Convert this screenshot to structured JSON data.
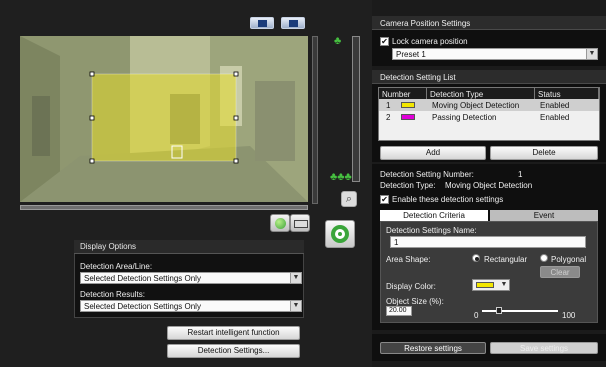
{
  "camera_view": {
    "toolbar": {
      "select_tool_icon": "pointer-icon",
      "window_tool_icon": "window-tool-icon"
    },
    "playback_status_icon": "green-status-dot-icon",
    "rectangle_tool_icon": "rectangle-tool-icon",
    "zoom_icon": "magnify-icon",
    "center_icon": "target-icon",
    "tree_icons": [
      "single-tree-icon",
      "multi-tree-icon"
    ]
  },
  "display_options": {
    "title": "Display Options",
    "area_label": "Detection Area/Line:",
    "area_value": "Selected Detection Settings Only",
    "results_label": "Detection Results:",
    "results_value": "Selected Detection Settings Only"
  },
  "left_buttons": {
    "restart": "Restart intelligent function",
    "settings": "Detection Settings..."
  },
  "camera_position": {
    "title": "Camera Position Settings",
    "lock_label": "Lock camera position",
    "lock_checked": true,
    "preset_value": "Preset 1"
  },
  "detection_list": {
    "title": "Detection Setting List",
    "columns": [
      "Number",
      "Detection Type",
      "Status"
    ],
    "rows": [
      {
        "number": "1",
        "color": "#f2e600",
        "type": "Moving Object Detection",
        "status": "Enabled"
      },
      {
        "number": "2",
        "color": "#e000d8",
        "type": "Passing Detection",
        "status": "Enabled"
      }
    ],
    "add_label": "Add",
    "delete_label": "Delete"
  },
  "detection_detail": {
    "number_label": "Detection Setting Number:",
    "number_value": "1",
    "type_label": "Detection Type:",
    "type_value": "Moving Object Detection",
    "enable_label": "Enable these detection settings",
    "enable_checked": true,
    "tabs": [
      "Detection Criteria",
      "Event"
    ],
    "name_label": "Detection Settings Name:",
    "name_value": "1",
    "area_shape_label": "Area Shape:",
    "rect_label": "Rectangular",
    "poly_label": "Polygonal",
    "clear_label": "Clear",
    "color_label": "Display Color:",
    "color_value": "#f2e600",
    "size_label": "Object Size (%):",
    "size_value": "20.00",
    "size_min": "0",
    "size_max": "100",
    "size_fraction": 0.2
  },
  "footer": {
    "restore_label": "Restore settings",
    "save_label": "Save settings"
  }
}
